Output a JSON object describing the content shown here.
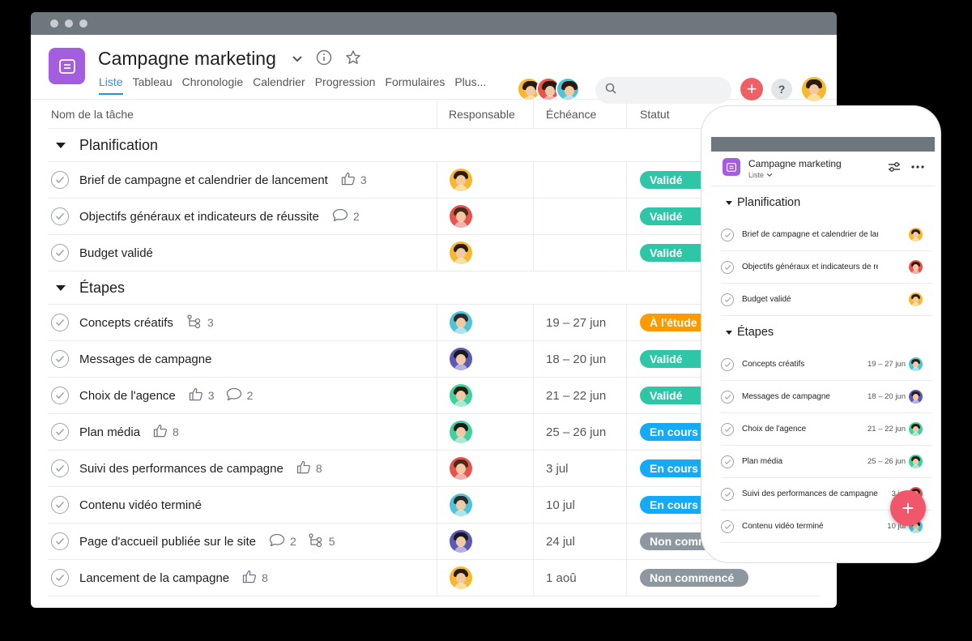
{
  "project": {
    "title": "Campagne marketing"
  },
  "tabs": [
    "Liste",
    "Tableau",
    "Chronologie",
    "Calendrier",
    "Progression",
    "Formulaires",
    "Plus..."
  ],
  "columns": {
    "name": "Nom de la tâche",
    "resp": "Responsable",
    "due": "Échéance",
    "status": "Statut"
  },
  "sections": [
    {
      "title": "Planification",
      "rows": [
        {
          "name": "Brief de campagne et calendrier de lancement",
          "likes": "3",
          "comments": "",
          "subtasks": "",
          "due": "",
          "status": "Validé",
          "statusColor": "#2fc6a7",
          "avatar": "#f5b82e",
          "hair": "#2a1a10"
        },
        {
          "name": "Objectifs généraux et indicateurs de réussite",
          "likes": "",
          "comments": "2",
          "subtasks": "",
          "due": "",
          "status": "Validé",
          "statusColor": "#2fc6a7",
          "avatar": "#e8534d",
          "hair": "#4a2a1a"
        },
        {
          "name": "Budget validé",
          "likes": "",
          "comments": "",
          "subtasks": "",
          "due": "",
          "status": "Validé",
          "statusColor": "#2fc6a7",
          "avatar": "#f5b82e",
          "hair": "#2a1a10"
        }
      ]
    },
    {
      "title": "Étapes",
      "rows": [
        {
          "name": "Concepts créatifs",
          "likes": "",
          "comments": "",
          "subtasks": "3",
          "due": "19 – 27 jun",
          "status": "À l'étude",
          "statusColor": "#fd9a00",
          "avatar": "#4fc3d8",
          "hair": "#2a2a2a"
        },
        {
          "name": "Messages de campagne",
          "likes": "",
          "comments": "",
          "subtasks": "",
          "due": "18 – 20 jun",
          "status": "Validé",
          "statusColor": "#2fc6a7",
          "avatar": "#5b58b6",
          "hair": "#1a1a1a"
        },
        {
          "name": "Choix de l'agence",
          "likes": "3",
          "comments": "2",
          "subtasks": "",
          "due": "21 – 22 jun",
          "status": "Validé",
          "statusColor": "#2fc6a7",
          "avatar": "#3fd19f",
          "hair": "#2a1a10"
        },
        {
          "name": "Plan média",
          "likes": "8",
          "comments": "",
          "subtasks": "",
          "due": "25 – 26 jun",
          "status": "En cours",
          "statusColor": "#14aaf5",
          "avatar": "#3fd19f",
          "hair": "#1a1a1a"
        },
        {
          "name": "Suivi des performances de campagne",
          "likes": "8",
          "comments": "",
          "subtasks": "",
          "due": "3 jul",
          "status": "En cours",
          "statusColor": "#14aaf5",
          "avatar": "#e8534d",
          "hair": "#4a2a1a"
        },
        {
          "name": "Contenu vidéo terminé",
          "likes": "",
          "comments": "",
          "subtasks": "",
          "due": "10 jul",
          "status": "En cours",
          "statusColor": "#14aaf5",
          "avatar": "#4fc3d8",
          "hair": "#2a2a2a"
        },
        {
          "name": "Page d'accueil publiée sur le site",
          "likes": "",
          "comments": "2",
          "subtasks": "5",
          "due": "24 jul",
          "status": "Non commencé",
          "statusColor": "#8d979f",
          "avatar": "#5b58b6",
          "hair": "#1a1a1a"
        },
        {
          "name": "Lancement de la campagne",
          "likes": "8",
          "comments": "",
          "subtasks": "",
          "due": "1 aoû",
          "status": "Non commencé",
          "statusColor": "#8d979f",
          "avatar": "#f5b82e",
          "hair": "#2a1a10"
        }
      ]
    }
  ],
  "mobile": {
    "title": "Campagne marketing",
    "view": "Liste",
    "sections": [
      {
        "title": "Planification",
        "rows": [
          {
            "name": "Brief de campagne et calendrier de lancement",
            "due": "",
            "avatar": "#f5b82e"
          },
          {
            "name": "Objectifs généraux et indicateurs de réussite",
            "due": "",
            "avatar": "#e8534d"
          },
          {
            "name": "Budget validé",
            "due": "",
            "avatar": "#f5b82e"
          }
        ]
      },
      {
        "title": "Étapes",
        "rows": [
          {
            "name": "Concepts créatifs",
            "due": "19 – 27 jun",
            "avatar": "#4fc3d8"
          },
          {
            "name": "Messages de campagne",
            "due": "18 – 20 jun",
            "avatar": "#5b58b6"
          },
          {
            "name": "Choix de l'agence",
            "due": "21 – 22 jun",
            "avatar": "#3fd19f"
          },
          {
            "name": "Plan média",
            "due": "25 – 26 jun",
            "avatar": "#3fd19f"
          },
          {
            "name": "Suivi des performances de campagne",
            "due": "3 jul",
            "avatar": "#e8534d"
          },
          {
            "name": "Contenu vidéo terminé",
            "due": "10 jul",
            "avatar": "#4fc3d8"
          }
        ]
      }
    ]
  },
  "header_avatars": [
    "#f5b82e",
    "#e8534d",
    "#4fc3d8"
  ],
  "me_avatar": "#f5b82e",
  "help_label": "?",
  "add_label": "+",
  "colors": {
    "accent": "#2e8fdc",
    "project": "#a35ee0",
    "add": "#ef5f66"
  }
}
